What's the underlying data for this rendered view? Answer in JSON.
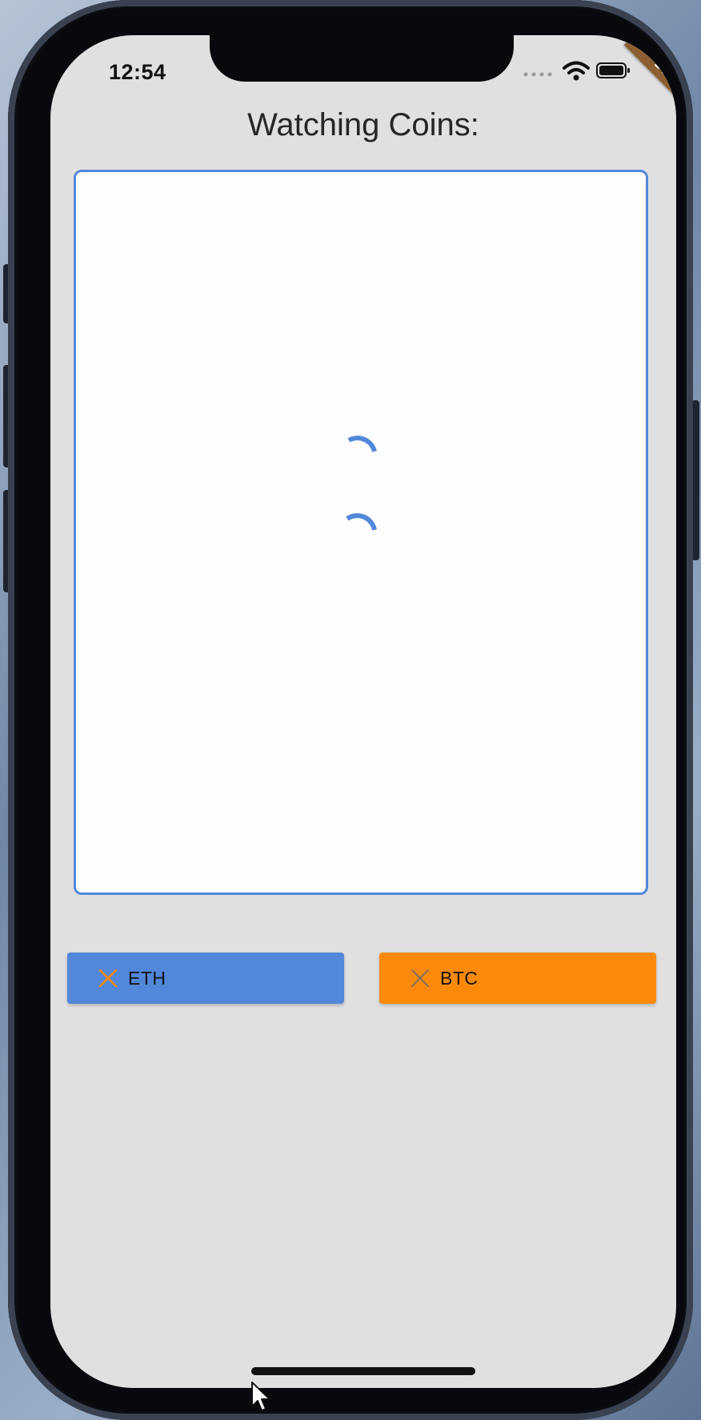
{
  "status_bar": {
    "time": "12:54",
    "icons": [
      "cellular-icon",
      "wifi-icon",
      "battery-icon"
    ]
  },
  "debug_banner": {
    "label": "DEBUG",
    "color": "#8d5f32"
  },
  "page": {
    "title": "Watching Coins:"
  },
  "coins_panel": {
    "border_color": "#5287da",
    "loading_indicators": 2
  },
  "coin_buttons": [
    {
      "label": "ETH",
      "icon": "close-icon",
      "color": "#5287da",
      "icon_color": "#fb8a0b"
    },
    {
      "label": "BTC",
      "icon": "close-icon",
      "color": "#fb8a0b",
      "icon_color": "#6b6b6b"
    }
  ]
}
